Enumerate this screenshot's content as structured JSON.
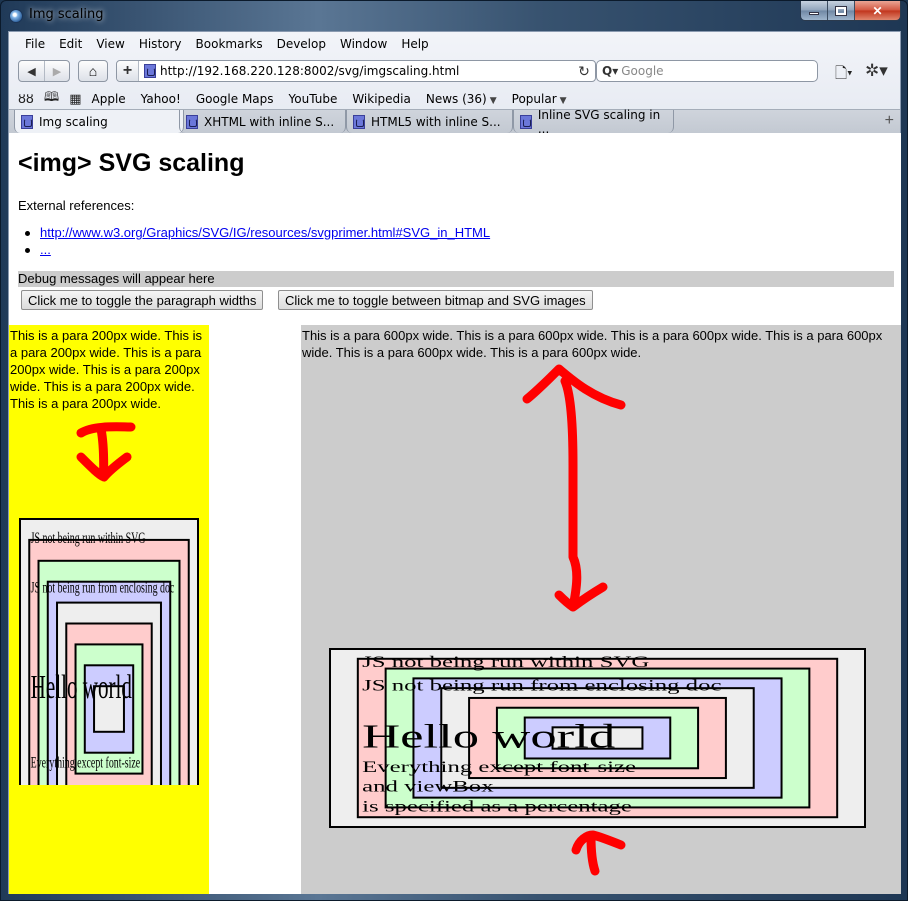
{
  "window": {
    "title": "Img scaling"
  },
  "menu": [
    "File",
    "Edit",
    "View",
    "History",
    "Bookmarks",
    "Develop",
    "Window",
    "Help"
  ],
  "toolbar": {
    "url": "http://192.168.220.128:8002/svg/imgscaling.html",
    "search_placeholder": "Google",
    "icons": [
      "back-icon",
      "forward-icon",
      "home-icon",
      "add-bookmark-icon",
      "reload-icon",
      "page-menu-icon",
      "gear-menu-icon"
    ]
  },
  "bookmarks": {
    "items": [
      "Apple",
      "Yahoo!",
      "Google Maps",
      "YouTube",
      "Wikipedia"
    ],
    "news": "News (36)",
    "popular": "Popular"
  },
  "tabs": [
    {
      "label": "Img scaling",
      "active": true
    },
    {
      "label": "XHTML with inline S...",
      "active": false
    },
    {
      "label": "HTML5 with inline S...",
      "active": false
    },
    {
      "label": "Inline SVG scaling in ...",
      "active": false
    }
  ],
  "page": {
    "heading": "<img> SVG scaling",
    "ext_refs_label": "External references:",
    "links": [
      "http://www.w3.org/Graphics/SVG/IG/resources/svgprimer.html#SVG_in_HTML",
      "..."
    ],
    "debug": "Debug messages will appear here",
    "buttons": {
      "toggle_widths": "Click me to toggle the paragraph widths",
      "toggle_images": "Click me to toggle between bitmap and SVG images"
    },
    "para_left": "This is a para 200px wide. This is a para 200px wide. This is a para 200px wide. This is a para 200px wide. This is a para 200px wide. This is a para 200px wide.",
    "para_right": "This is a para 600px wide. This is a para 600px wide. This is a para 600px wide. This is a para 600px wide. This is a para 600px wide. This is a para 600px wide.",
    "svg_text": {
      "line1": "JS not being run within SVG",
      "line2": "JS not being run from enclosing doc",
      "hello": "Hello world",
      "note1": "Everything except font-size",
      "note2": "and viewBox",
      "note3": "is specified as a percentage"
    },
    "colors": {
      "yellow": "#ffff00",
      "gray": "#cccccc",
      "arrow": "#ff0000",
      "link": "#0000ee",
      "rect_fills": [
        "#eeeeee",
        "#ffcccc",
        "#ccffcc",
        "#ccccff",
        "#eeeeee",
        "#ffcccc",
        "#ccffcc",
        "#ccccff",
        "#eeeeee"
      ]
    }
  }
}
